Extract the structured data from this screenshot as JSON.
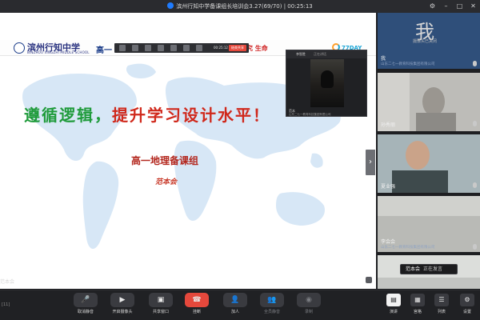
{
  "window": {
    "title": "滨州行知中学备课组长培训会3.27(69/70) | 00:25:13"
  },
  "slide": {
    "school_name": "滨州行知中学",
    "school_name_en": "BINZHOU XINGZHI MIDDLE SCHOOL",
    "course_fragment": "高一",
    "motto": "探究 生命",
    "brand": "77DAY",
    "title_green": "遵循逻辑，",
    "title_red": "提升学习设计水平！",
    "subtitle": "高一地理备课组",
    "author": "范本会"
  },
  "minibar": {
    "time": "00:25:12",
    "stop_label": "结束共享"
  },
  "pip": {
    "header_name": "李智胜",
    "header_status": "正在讲话",
    "footer_name": "范本",
    "footer_org": "山东二七一教育科技集团有限公司"
  },
  "stage_footer": {
    "speaker_prefix": "范本会"
  },
  "participants": [
    {
      "avatar_text": "我",
      "status": "摄像头已关闭",
      "name": "我",
      "org": "山东二七一教育科技集团有限公司"
    },
    {
      "name": "孙秀丽",
      "org": ""
    },
    {
      "name": "夏业强",
      "org": ""
    },
    {
      "name": "李会会",
      "org": "山东二七一教育科技集团有限公司"
    },
    {
      "name": "范本会",
      "status": "正在发言"
    }
  ],
  "toolbar": {
    "left_label": "[11]",
    "items": [
      {
        "label": "取消静音",
        "icon": "microphone-icon"
      },
      {
        "label": "开启摄像头",
        "icon": "camera-icon"
      },
      {
        "label": "共享窗口",
        "icon": "share-screen-icon"
      },
      {
        "label": "挂断",
        "icon": "hangup-icon"
      },
      {
        "label": "加人",
        "icon": "add-person-icon"
      },
      {
        "label": "全员静音",
        "icon": "mute-all-icon"
      },
      {
        "label": "录制",
        "icon": "record-icon"
      }
    ],
    "right_items": [
      {
        "label": "演讲",
        "icon": "speaker-view-icon"
      },
      {
        "label": "宫格",
        "icon": "grid-view-icon"
      },
      {
        "label": "列表",
        "icon": "list-icon"
      },
      {
        "label": "设置",
        "icon": "gear-icon"
      }
    ]
  },
  "colors": {
    "accent_red": "#e5483c",
    "title_green": "#1f9b3b",
    "title_red": "#d0281b"
  }
}
